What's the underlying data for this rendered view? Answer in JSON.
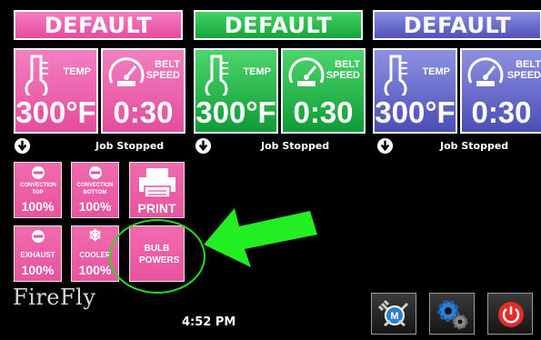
{
  "zones": [
    {
      "title": "DEFAULT",
      "temp_label": "TEMP",
      "speed_label": "BELT\nSPEED",
      "temp_value": "300°F",
      "speed_value": "0:30",
      "status": "Job Stopped",
      "colors": {
        "header": "#ee61b0",
        "light": "#f48bc4",
        "dark": "#e5459a"
      }
    },
    {
      "title": "DEFAULT",
      "temp_label": "TEMP",
      "speed_label": "BELT\nSPEED",
      "temp_value": "300°F",
      "speed_value": "0:30",
      "status": "Job Stopped",
      "colors": {
        "header": "#29c04c",
        "light": "#4fd46c",
        "dark": "#12a23a"
      }
    },
    {
      "title": "DEFAULT",
      "temp_label": "TEMP",
      "speed_label": "BELT\nSPEED",
      "temp_value": "300°F",
      "speed_value": "0:30",
      "status": "Job Stopped",
      "colors": {
        "header": "#6b6fcf",
        "light": "#8c8fe0",
        "dark": "#5457bd"
      }
    }
  ],
  "controls": {
    "convection_top": {
      "label": "CONVECTION TOP",
      "value": "100%"
    },
    "convection_bottom": {
      "label": "CONVECTION BOTTOM",
      "value": "100%"
    },
    "print": {
      "label": "PRINT"
    },
    "exhaust": {
      "label": "EXHAUST",
      "value": "100%"
    },
    "cooler": {
      "label": "COOLER",
      "value": "100%"
    },
    "bulb_powers": {
      "label": "BULB POWERS"
    }
  },
  "logo": "FireFly",
  "clock": "4:52 PM",
  "annotation": {
    "arrow_color": "#22ee22",
    "circle_color": "#22dd22"
  },
  "icons": {
    "status": "down-arrow-circle-icon",
    "temp": "thermometer-icon",
    "speed": "speedometer-icon",
    "maintenance": "wrench-m-icon",
    "settings": "gears-icon",
    "power": "power-icon"
  }
}
